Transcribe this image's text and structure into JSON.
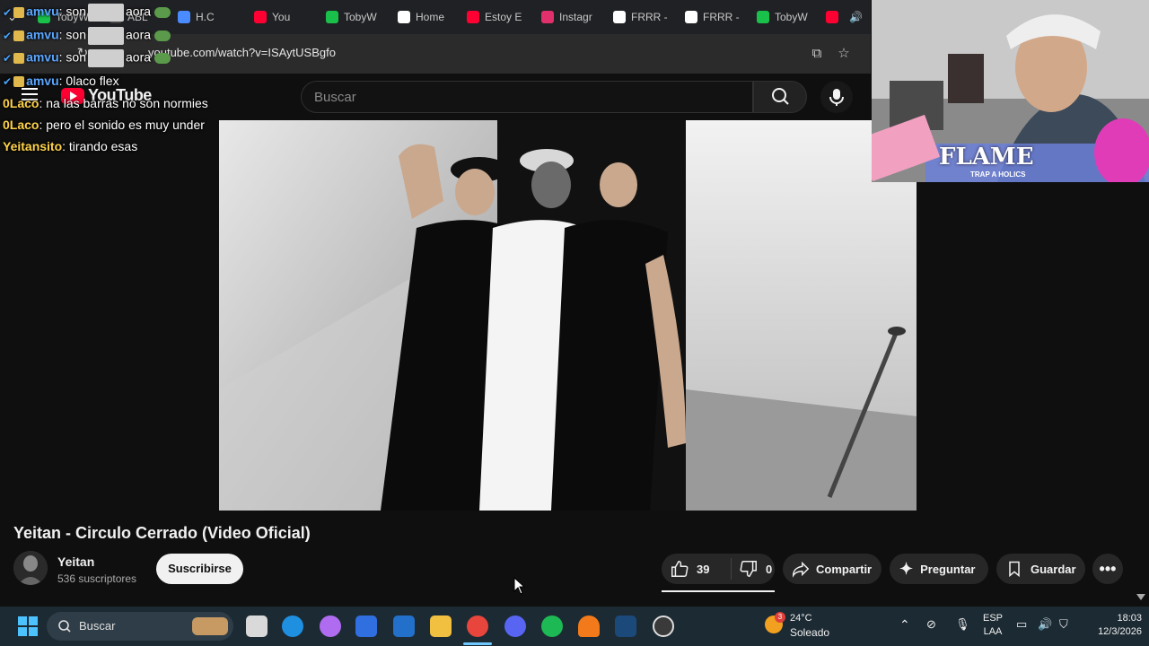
{
  "browser": {
    "tabs": [
      {
        "label": "TobyW",
        "color": "#19c14a"
      },
      {
        "label": "ABL",
        "color": "#444"
      },
      {
        "label": "H.C",
        "color": "#4a8cff"
      },
      {
        "label": "You",
        "color": "#ff0033"
      },
      {
        "label": "TobyW",
        "color": "#19c14a"
      },
      {
        "label": "Home",
        "color": "#ffffff"
      },
      {
        "label": "Estoy E",
        "color": "#ff0033"
      },
      {
        "label": "Instagr",
        "color": "#e1306c"
      },
      {
        "label": "FRRR -",
        "color": "#ffffff"
      },
      {
        "label": "FRRR -",
        "color": "#ffffff"
      },
      {
        "label": "TobyW",
        "color": "#19c14a"
      }
    ],
    "url": "youtube.com/watch?v=ISAytUSBgfo"
  },
  "youtube": {
    "logo_text": "YouTube",
    "search_placeholder": "Buscar"
  },
  "chat": [
    {
      "user": "amvu",
      "text": "son",
      "emote_after": "aora"
    },
    {
      "user": "amvu",
      "text": "son",
      "emote_after": "aora"
    },
    {
      "user": "amvu",
      "text": "son",
      "emote_after": "aora"
    },
    {
      "user": "amvu",
      "text": "0laco flex",
      "emote_after": ""
    },
    {
      "user": "0Laco",
      "text": "na las barras no son normies"
    },
    {
      "user": "0Laco",
      "text": "pero el sonido es muy under"
    },
    {
      "user": "Yeitansito",
      "text": "tirando esas"
    }
  ],
  "webcam": {
    "overlay_title": "FLAME",
    "overlay_sub": "TRAP A HOLICS"
  },
  "video": {
    "title": "Yeitan - Circulo Cerrado (Video Oficial)",
    "channel": "Yeitan",
    "subscribers": "536 suscriptores",
    "subscribe_label": "Suscribirse",
    "likes": "39",
    "dislikes": "0",
    "share_label": "Compartir",
    "ask_label": "Preguntar",
    "save_label": "Guardar"
  },
  "taskbar": {
    "search_label": "Buscar",
    "weather_temp": "24°C",
    "weather_desc": "Soleado",
    "weather_badge": "3",
    "lang_top": "ESP",
    "lang_bottom": "LAA",
    "time": "18:03",
    "date": "12/3/2026"
  }
}
